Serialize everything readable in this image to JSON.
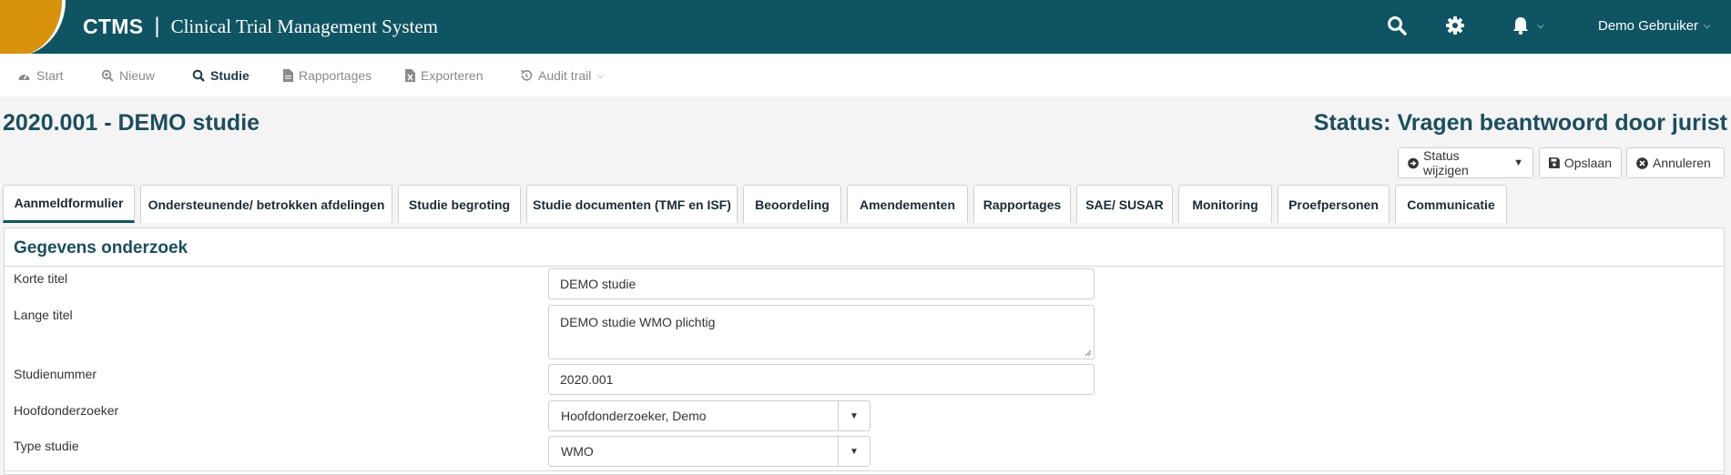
{
  "header": {
    "app_abbr": "CTMS",
    "separator": "|",
    "app_name": "Clinical Trial Management System",
    "user_name": "Demo Gebruiker",
    "colors": {
      "bar": "#0f5462",
      "logo": "#d8920b"
    }
  },
  "nav": {
    "items": [
      {
        "label": "Start",
        "icon": "dashboard-icon",
        "active": false
      },
      {
        "label": "Nieuw",
        "icon": "search-plus-icon",
        "active": false
      },
      {
        "label": "Studie",
        "icon": "search-icon",
        "active": true
      },
      {
        "label": "Rapportages",
        "icon": "file-icon",
        "active": false
      },
      {
        "label": "Exporteren",
        "icon": "file-excel-icon",
        "active": false
      },
      {
        "label": "Audit trail",
        "icon": "history-icon",
        "active": false
      }
    ]
  },
  "page": {
    "title": "2020.001 - DEMO studie",
    "status": "Status: Vragen beantwoord door jurist"
  },
  "actions": {
    "status_label": "Status wijzigen",
    "save_label": "Opslaan",
    "cancel_label": "Annuleren"
  },
  "tabs": [
    {
      "label": "Aanmeldformulier",
      "active": true
    },
    {
      "label": "Ondersteunende/ betrokken afdelingen"
    },
    {
      "label": "Studie begroting"
    },
    {
      "label": "Studie documenten (TMF en ISF)"
    },
    {
      "label": "Beoordeling"
    },
    {
      "label": "Amendementen"
    },
    {
      "label": "Rapportages"
    },
    {
      "label": "SAE/ SUSAR"
    },
    {
      "label": "Monitoring"
    },
    {
      "label": "Proefpersonen"
    },
    {
      "label": "Communicatie"
    }
  ],
  "form": {
    "section_title": "Gegevens onderzoek",
    "fields": {
      "korte_titel": {
        "label": "Korte titel",
        "value": "DEMO studie"
      },
      "lange_titel": {
        "label": "Lange titel",
        "value": "DEMO studie WMO plichtig"
      },
      "studienummer": {
        "label": "Studienummer",
        "value": "2020.001"
      },
      "hoofdonderzoeker": {
        "label": "Hoofdonderzoeker",
        "value": "Hoofdonderzoeker, Demo"
      },
      "type_studie": {
        "label": "Type studie",
        "value": "WMO"
      }
    }
  }
}
